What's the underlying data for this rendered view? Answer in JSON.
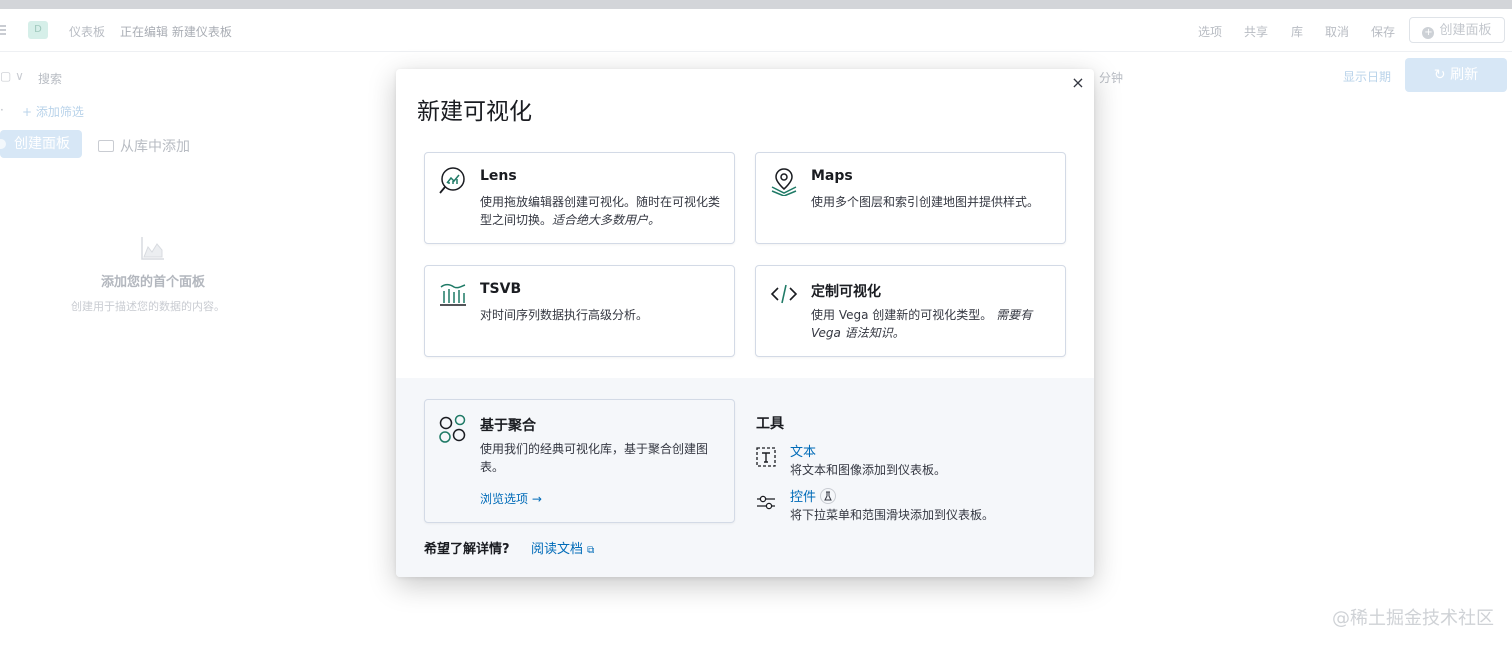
{
  "background": {
    "breadcrumbs": [
      "仪表板",
      "正在编辑 新建仪表板"
    ],
    "avatar_letter": "D",
    "header_actions": [
      "选项",
      "共享",
      "库",
      "取消",
      "保存"
    ],
    "create_panel_label": "创建面板",
    "search_placeholder": "搜索",
    "add_filter_label": "+ 添加筛选",
    "time_suffix": "分钟",
    "show_dates_label": "显示日期",
    "refresh_label": "刷新",
    "create_panel_button": "创建面板",
    "add_from_library": "从库中添加",
    "empty_title": "添加您的首个面板",
    "empty_subtitle": "创建用于描述您的数据的内容。",
    "watermark": "@稀土掘金技术社区"
  },
  "modal": {
    "title": "新建可视化",
    "close_glyph": "×",
    "cards": [
      {
        "title": "Lens",
        "desc": "使用拖放编辑器创建可视化。随时在可视化类型之间切换。",
        "desc_em": "适合绝大多数用户。"
      },
      {
        "title": "Maps",
        "desc": "使用多个图层和索引创建地图并提供样式。",
        "desc_em": ""
      },
      {
        "title": "TSVB",
        "desc": "对时间序列数据执行高级分析。",
        "desc_em": ""
      },
      {
        "title": "定制可视化",
        "desc": "使用 Vega 创建新的可视化类型。",
        "desc_em": "需要有 Vega 语法知识。"
      }
    ],
    "aggregation": {
      "title": "基于聚合",
      "desc": "使用我们的经典可视化库，基于聚合创建图表。",
      "browse_label": "浏览选项 →"
    },
    "tools": {
      "title": "工具",
      "items": [
        {
          "name": "文本",
          "desc": "将文本和图像添加到仪表板。"
        },
        {
          "name": "控件",
          "desc": "将下拉菜单和范围滑块添加到仪表板。"
        }
      ]
    },
    "learn_more": "希望了解详情?",
    "read_docs": "阅读文档"
  },
  "colors": {
    "accent": "#006bb8",
    "icon_green": "#1f7a66",
    "text": "#1a1c21"
  }
}
